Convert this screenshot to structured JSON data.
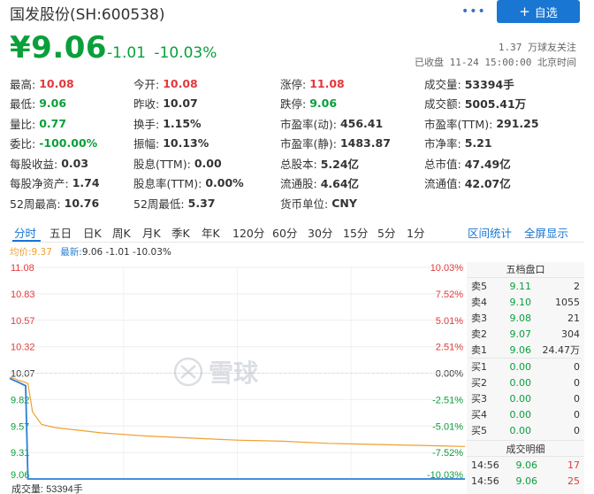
{
  "header": {
    "title": "国发股份(SH:600538)",
    "more_icon": "more-icon",
    "add_button": "自选",
    "add_icon": "plus-icon"
  },
  "price": {
    "current": "¥9.06",
    "change": "-1.01",
    "change_pct": "-10.03%",
    "followers": "1.37 万球友关注",
    "status": "已收盘 11-24 15:00:00 北京时间"
  },
  "quote_rows": [
    [
      {
        "label": "最高:",
        "value": "10.08",
        "color": "red"
      },
      {
        "label": "今开:",
        "value": "10.08",
        "color": "red"
      },
      {
        "label": "涨停:",
        "value": "11.08",
        "color": "red"
      },
      {
        "label": "成交量:",
        "value": "53394手",
        "color": ""
      }
    ],
    [
      {
        "label": "最低:",
        "value": "9.06",
        "color": "green"
      },
      {
        "label": "昨收:",
        "value": "10.07",
        "color": ""
      },
      {
        "label": "跌停:",
        "value": "9.06",
        "color": "green"
      },
      {
        "label": "成交额:",
        "value": "5005.41万",
        "color": ""
      }
    ],
    [
      {
        "label": "量比:",
        "value": "0.77",
        "color": "green"
      },
      {
        "label": "换手:",
        "value": "1.15%",
        "color": ""
      },
      {
        "label": "市盈率(动):",
        "value": "456.41",
        "color": ""
      },
      {
        "label": "市盈率(TTM):",
        "value": "291.25",
        "color": ""
      }
    ],
    [
      {
        "label": "委比:",
        "value": "-100.00%",
        "color": "green"
      },
      {
        "label": "振幅:",
        "value": "10.13%",
        "color": ""
      },
      {
        "label": "市盈率(静):",
        "value": "1483.87",
        "color": ""
      },
      {
        "label": "市净率:",
        "value": "5.21",
        "color": ""
      }
    ],
    [
      {
        "label": "每股收益:",
        "value": "0.03",
        "color": ""
      },
      {
        "label": "股息(TTM):",
        "value": "0.00",
        "color": ""
      },
      {
        "label": "总股本:",
        "value": "5.24亿",
        "color": ""
      },
      {
        "label": "总市值:",
        "value": "47.49亿",
        "color": ""
      }
    ],
    [
      {
        "label": "每股净资产:",
        "value": "1.74",
        "color": ""
      },
      {
        "label": "股息率(TTM):",
        "value": "0.00%",
        "color": ""
      },
      {
        "label": "流通股:",
        "value": "4.64亿",
        "color": ""
      },
      {
        "label": "流通值:",
        "value": "42.07亿",
        "color": ""
      }
    ],
    [
      {
        "label": "52周最高:",
        "value": "10.76",
        "color": ""
      },
      {
        "label": "52周最低:",
        "value": "5.37",
        "color": ""
      },
      {
        "label": "货币单位:",
        "value": "CNY",
        "color": ""
      },
      {
        "label": "",
        "value": "",
        "color": ""
      }
    ]
  ],
  "tabs": [
    "分时",
    "五日",
    "日K",
    "周K",
    "月K",
    "季K",
    "年K",
    "120分",
    "60分",
    "30分",
    "15分",
    "5分",
    "1分"
  ],
  "tab_links": [
    "区间统计",
    "全屏显示"
  ],
  "legend": {
    "avg": "均价:9.37",
    "latest_label": "最新:",
    "latest_value": "9.06 -1.01 -10.03%"
  },
  "watermark": "雪球",
  "volume_label": "成交量: 53394手",
  "chart_data": {
    "type": "line",
    "ylim": [
      9.06,
      11.08
    ],
    "y_ticks": [
      "11.08",
      "10.83",
      "10.57",
      "10.32",
      "10.07",
      "9.82",
      "9.57",
      "9.31",
      "9.06"
    ],
    "pct_ticks": [
      "10.03%",
      "7.52%",
      "5.01%",
      "2.51%",
      "0.00%",
      "-2.51%",
      "-5.01%",
      "-7.52%",
      "-10.03%"
    ],
    "prev_close": 10.07,
    "series": [
      {
        "name": "最新",
        "color": "#2a7fd4",
        "x": [
          0,
          0.01,
          0.02,
          0.03,
          0.035,
          0.04,
          1.0
        ],
        "values": [
          10.02,
          10.0,
          9.98,
          9.96,
          9.95,
          9.06,
          9.06
        ]
      },
      {
        "name": "均价",
        "color": "#f0a030",
        "x": [
          0,
          0.01,
          0.02,
          0.03,
          0.04,
          0.05,
          0.07,
          0.1,
          0.2,
          0.3,
          0.4,
          0.5,
          0.6,
          0.7,
          0.8,
          0.9,
          1.0
        ],
        "values": [
          10.03,
          10.02,
          10.0,
          9.99,
          9.97,
          9.7,
          9.58,
          9.55,
          9.5,
          9.47,
          9.45,
          9.43,
          9.42,
          9.4,
          9.39,
          9.38,
          9.37
        ]
      }
    ]
  },
  "order_book": {
    "title": "五档盘口",
    "rows": [
      {
        "label": "卖5",
        "price": "9.11",
        "vol": "2",
        "color": "green"
      },
      {
        "label": "卖4",
        "price": "9.10",
        "vol": "1055",
        "color": "green"
      },
      {
        "label": "卖3",
        "price": "9.08",
        "vol": "21",
        "color": "green"
      },
      {
        "label": "卖2",
        "price": "9.07",
        "vol": "304",
        "color": "green"
      },
      {
        "label": "卖1",
        "price": "9.06",
        "vol": "24.47万",
        "color": "green"
      },
      {
        "label": "买1",
        "price": "0.00",
        "vol": "0",
        "color": "green"
      },
      {
        "label": "买2",
        "price": "0.00",
        "vol": "0",
        "color": "green"
      },
      {
        "label": "买3",
        "price": "0.00",
        "vol": "0",
        "color": "green"
      },
      {
        "label": "买4",
        "price": "0.00",
        "vol": "0",
        "color": "green"
      },
      {
        "label": "买5",
        "price": "0.00",
        "vol": "0",
        "color": "green"
      }
    ]
  },
  "trades": {
    "title": "成交明细",
    "rows": [
      {
        "time": "14:56",
        "price": "9.06",
        "vol": "17"
      },
      {
        "time": "14:56",
        "price": "9.06",
        "vol": "25"
      }
    ]
  },
  "colors": {
    "up": "#e4393c",
    "down": "#0a9f3b",
    "accent": "#1976d2",
    "avg_line": "#f0a030",
    "price_line": "#2a7fd4"
  }
}
